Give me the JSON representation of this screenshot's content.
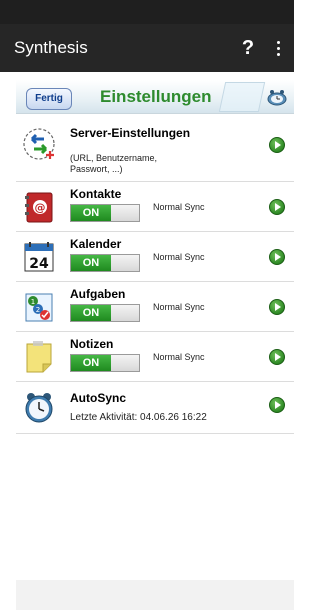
{
  "app": {
    "title": "Synthesis",
    "help_label": "?"
  },
  "settings_bar": {
    "done_label": "Fertig",
    "title": "Einstellungen"
  },
  "rows": {
    "server": {
      "name": "Server-Einstellungen",
      "description": "(URL, Benutzername, Passwort, ...)"
    },
    "contacts": {
      "name": "Kontakte",
      "toggle": "ON",
      "sync_mode": "Normal Sync"
    },
    "calendar": {
      "name": "Kalender",
      "toggle": "ON",
      "sync_mode": "Normal Sync",
      "icon_day": "24"
    },
    "tasks": {
      "name": "Aufgaben",
      "toggle": "ON",
      "sync_mode": "Normal Sync"
    },
    "notes": {
      "name": "Notizen",
      "toggle": "ON",
      "sync_mode": "Normal Sync"
    },
    "autosync": {
      "name": "AutoSync",
      "last_activity": "Letzte Aktivität: 04.06.26  16:22"
    }
  },
  "colors": {
    "accent_green": "#2e8b2e",
    "toggle_on": "#2a9a2a",
    "appbar": "#262626"
  }
}
